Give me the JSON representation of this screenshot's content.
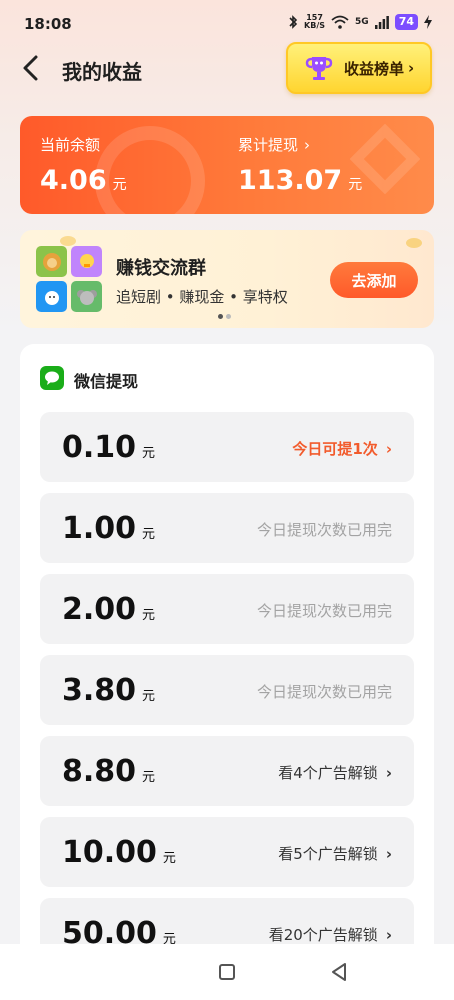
{
  "status_bar": {
    "time": "18:08",
    "net_speed_value": "157",
    "net_speed_unit": "KB/S",
    "network": "5G",
    "battery": "74",
    "icons": [
      "bluetooth-icon",
      "wifi-icon",
      "signal-icon",
      "battery-icon",
      "charging-icon"
    ]
  },
  "header": {
    "title": "我的收益",
    "rank_button": "收益榜单",
    "rank_chevron": "›"
  },
  "balance": {
    "current_label": "当前余额",
    "current_value": "4.06",
    "current_unit": "元",
    "total_label": "累计提现",
    "total_chevron": "›",
    "total_value": "113.07",
    "total_unit": "元"
  },
  "group_banner": {
    "title": "赚钱交流群",
    "subtitle": "追短剧 • 赚现金 • 享特权",
    "button": "去添加"
  },
  "withdraw": {
    "title": "微信提现",
    "options": [
      {
        "amount": "0.10",
        "unit": "元",
        "status": "今日可提1次",
        "chevron": "›",
        "type": "active"
      },
      {
        "amount": "1.00",
        "unit": "元",
        "status": "今日提现次数已用完",
        "chevron": "",
        "type": "used"
      },
      {
        "amount": "2.00",
        "unit": "元",
        "status": "今日提现次数已用完",
        "chevron": "",
        "type": "used"
      },
      {
        "amount": "3.80",
        "unit": "元",
        "status": "今日提现次数已用完",
        "chevron": "",
        "type": "used"
      },
      {
        "amount": "8.80",
        "unit": "元",
        "status": "看4个广告解锁",
        "chevron": "›",
        "type": "ad"
      },
      {
        "amount": "10.00",
        "unit": "元",
        "status": "看5个广告解锁",
        "chevron": "›",
        "type": "ad"
      },
      {
        "amount": "50.00",
        "unit": "元",
        "status": "看20个广告解锁",
        "chevron": "›",
        "type": "ad"
      }
    ]
  },
  "colors": {
    "accent": "#ff5a2a",
    "active_status": "#f25b2c",
    "rank_button": "#ffd530",
    "wechat_green": "#1aad19"
  }
}
